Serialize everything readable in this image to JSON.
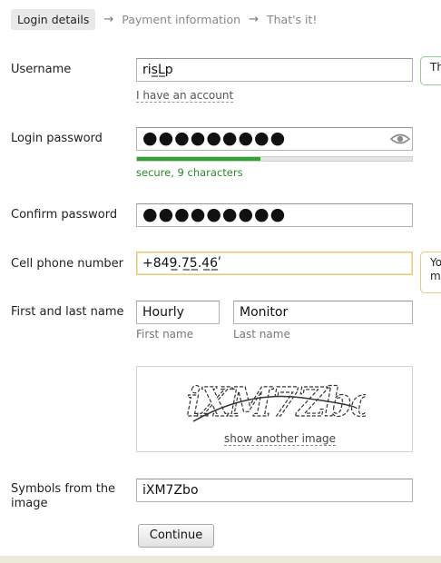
{
  "steps": {
    "step1": "Login details",
    "step2": "Payment information",
    "step3": "That's it!",
    "arrow": "→"
  },
  "form": {
    "username": {
      "label": "Username",
      "value": "ris̲L̲p",
      "link": "I have an account",
      "tooltip": "Th"
    },
    "password": {
      "label": "Login password",
      "value": "●●●●●●●●●",
      "strength_text": "secure, 9 characters",
      "strength": 0.45,
      "eye_icon": "eye-icon"
    },
    "confirm": {
      "label": "Confirm password",
      "value": "●●●●●●●●●"
    },
    "phone": {
      "label": "Cell phone number",
      "value": "+849̲.7̲5̲̲.4̲6̲ʹ",
      "tooltip_line1": "Yo",
      "tooltip_line2": "m"
    },
    "name": {
      "label": "First and last name",
      "first_value": "Hourly",
      "last_value": "Monitor",
      "first_label": "First name",
      "last_label": "Last name"
    },
    "captcha": {
      "image_text": "iXM7Zbo",
      "link": "show another image",
      "label": "Symbols from the image",
      "value": "iXM7Zbo"
    },
    "continue_label": "Continue"
  },
  "colors": {
    "strength_fill": "#2ea52e",
    "tooltip_ok_border": "#8fcf8f",
    "tooltip_warn_border": "#e5c97c",
    "footer": "#ece9dd"
  }
}
